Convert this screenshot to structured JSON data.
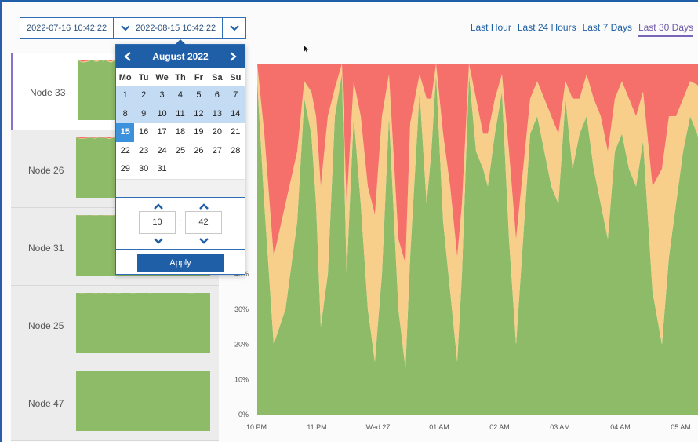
{
  "toolbar": {
    "start_date": "2022-07-16 10:42:22",
    "end_date": "2022-08-15 10:42:22",
    "ranges": [
      {
        "label": "Last Hour",
        "active": false
      },
      {
        "label": "Last 24 Hours",
        "active": false
      },
      {
        "label": "Last 7 Days",
        "active": false
      },
      {
        "label": "Last 30 Days",
        "active": true
      }
    ]
  },
  "nodes": [
    {
      "label": "Node 33",
      "selected": true
    },
    {
      "label": "Node 26",
      "selected": false
    },
    {
      "label": "Node 31",
      "selected": false
    },
    {
      "label": "Node 25",
      "selected": false
    },
    {
      "label": "Node 47",
      "selected": false
    }
  ],
  "picker": {
    "month_label": "August 2022",
    "weekdays": [
      "Mo",
      "Tu",
      "We",
      "Th",
      "Fr",
      "Sa",
      "Su"
    ],
    "days": [
      "1",
      "2",
      "3",
      "4",
      "5",
      "6",
      "7",
      "8",
      "9",
      "10",
      "11",
      "12",
      "13",
      "14",
      "15",
      "16",
      "17",
      "18",
      "19",
      "20",
      "21",
      "22",
      "23",
      "24",
      "25",
      "26",
      "27",
      "28",
      "29",
      "30",
      "31"
    ],
    "selected_day": "15",
    "hour": "10",
    "minute": "42",
    "colon": ":",
    "apply_label": "Apply",
    "icons": {
      "prev": "chevron-left-icon",
      "next": "chevron-right-icon",
      "up": "chevron-up-icon",
      "down": "chevron-down-icon"
    }
  },
  "colors": {
    "green": "#8ebb68",
    "yellow": "#f7cf8a",
    "red": "#f5706a",
    "accent": "#1f5fa8",
    "active_tab": "#7a66b8"
  },
  "chart_data": {
    "type": "area",
    "stacked": true,
    "y_unit": "%",
    "ylim": [
      0,
      100
    ],
    "yticks": [
      "0%",
      "10%",
      "20%",
      "30%",
      "40%"
    ],
    "xticks": [
      "10 PM",
      "11 PM",
      "Wed 27",
      "01 AM",
      "02 AM",
      "03 AM",
      "04 AM",
      "05 AM"
    ],
    "x": [
      0,
      0.015,
      0.035,
      0.06,
      0.085,
      0.1,
      0.115,
      0.125,
      0.135,
      0.15,
      0.165,
      0.18,
      0.19,
      0.205,
      0.22,
      0.235,
      0.25,
      0.265,
      0.28,
      0.3,
      0.315,
      0.325,
      0.345,
      0.36,
      0.37,
      0.38,
      0.395,
      0.41,
      0.425,
      0.435,
      0.45,
      0.465,
      0.48,
      0.49,
      0.505,
      0.52,
      0.535,
      0.55,
      0.565,
      0.58,
      0.595,
      0.61,
      0.625,
      0.64,
      0.655,
      0.67,
      0.685,
      0.7,
      0.715,
      0.73,
      0.745,
      0.76,
      0.775,
      0.79,
      0.805,
      0.82,
      0.84,
      0.86,
      0.875,
      0.89,
      0.905,
      0.92,
      0.935,
      0.95,
      0.965,
      0.985,
      1
    ],
    "series": [
      {
        "name": "green",
        "values": [
          95,
          60,
          20,
          30,
          55,
          90,
          80,
          60,
          25,
          40,
          85,
          97,
          40,
          85,
          60,
          30,
          15,
          40,
          85,
          30,
          13,
          45,
          92,
          60,
          75,
          97,
          55,
          35,
          15,
          40,
          97,
          75,
          70,
          65,
          80,
          92,
          50,
          20,
          50,
          80,
          85,
          75,
          65,
          60,
          90,
          70,
          80,
          85,
          70,
          60,
          50,
          75,
          80,
          70,
          65,
          78,
          35,
          20,
          45,
          60,
          75,
          85,
          80,
          70,
          60,
          55,
          80
        ]
      },
      {
        "name": "yellow",
        "values": [
          5,
          20,
          25,
          30,
          20,
          5,
          12,
          25,
          40,
          45,
          8,
          3,
          20,
          10,
          25,
          35,
          42,
          45,
          12,
          20,
          30,
          38,
          5,
          30,
          15,
          3,
          25,
          30,
          30,
          20,
          3,
          15,
          10,
          15,
          10,
          5,
          25,
          30,
          20,
          10,
          10,
          15,
          20,
          20,
          5,
          20,
          10,
          12,
          20,
          25,
          25,
          15,
          15,
          20,
          20,
          14,
          30,
          50,
          40,
          25,
          15,
          10,
          14,
          20,
          25,
          25,
          20
        ]
      },
      {
        "name": "red",
        "values": [
          0,
          20,
          55,
          40,
          25,
          5,
          8,
          15,
          35,
          15,
          7,
          0,
          40,
          5,
          15,
          35,
          43,
          15,
          3,
          50,
          57,
          17,
          3,
          10,
          10,
          0,
          20,
          35,
          55,
          40,
          0,
          10,
          20,
          20,
          10,
          3,
          25,
          50,
          30,
          10,
          5,
          10,
          15,
          20,
          5,
          10,
          10,
          3,
          10,
          15,
          25,
          10,
          5,
          10,
          15,
          8,
          35,
          30,
          15,
          15,
          10,
          5,
          6,
          10,
          15,
          20,
          0
        ]
      }
    ]
  }
}
